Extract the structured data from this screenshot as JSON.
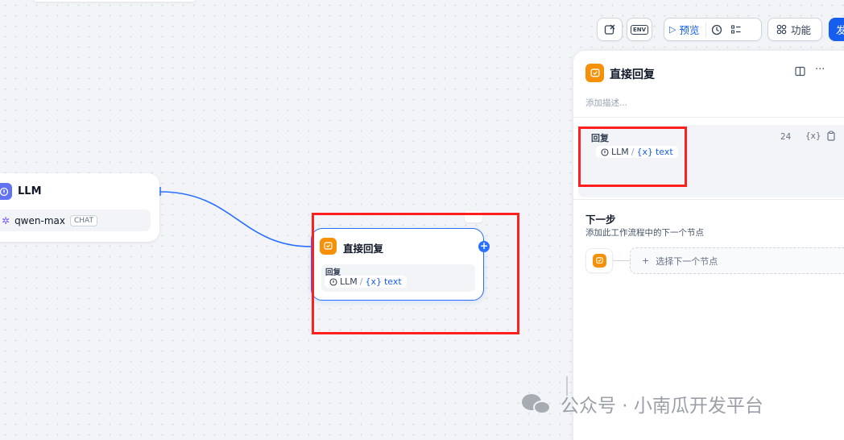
{
  "toolbar": {
    "preview_label": "预览",
    "features_label": "功能",
    "publish_label": "发",
    "env_label": "ENV"
  },
  "canvas": {
    "llm_node": {
      "title": "LLM",
      "model": "qwen-max",
      "model_mode": "CHAT"
    },
    "answer_node": {
      "title": "直接回复",
      "field_label": "回复",
      "source_node": "LLM",
      "separator": "/",
      "variable": "text",
      "variable_prefix": "{x}"
    },
    "more_glyph": "···",
    "add_glyph": "+"
  },
  "panel": {
    "title": "直接回复",
    "description_placeholder": "添加描述...",
    "answer": {
      "label": "回复",
      "char_count": "24",
      "var_button": "{x}",
      "source_node": "LLM",
      "separator": "/",
      "variable": "text",
      "variable_prefix": "{x}"
    },
    "next_step": {
      "title": "下一步",
      "description": "添加此工作流程中的下一个节点",
      "select_label": "选择下一个节点",
      "plus": "+"
    },
    "more_glyph": "···"
  },
  "watermark": {
    "text": "公众号 · 小南瓜开发平台"
  },
  "colors": {
    "primary": "#155eef",
    "edge": "#2970ff",
    "answer_node": "#f79009",
    "llm_node": "#6172f3",
    "highlight": "#ff1f1f"
  }
}
